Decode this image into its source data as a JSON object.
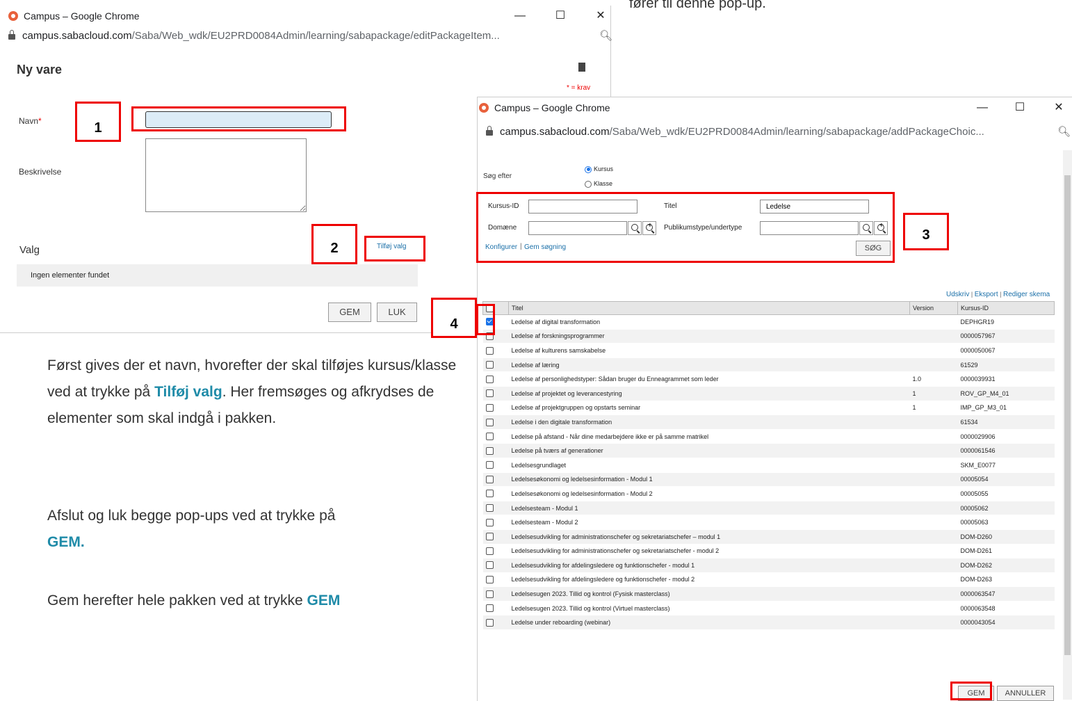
{
  "caption_top": "fører til denne pop-up.",
  "window1": {
    "title": "Campus – Google Chrome",
    "url_host": "campus.sabacloud.com",
    "url_path": "/Saba/Web_wdk/EU2PRD0084Admin/learning/sabapackage/editPackageItem...",
    "page_title": "Ny vare",
    "required_note": "* = krav",
    "name_label": "Navn",
    "required_star": "*",
    "name_value": "",
    "description_label": "Beskrivelse",
    "add_choice_link": "Tilføj valg",
    "choices_section": "Valg",
    "no_items": "Ingen elementer fundet",
    "save_button": "GEM",
    "close_button": "LUK"
  },
  "window2": {
    "title": "Campus – Google Chrome",
    "url_host": "campus.sabacloud.com",
    "url_path": "/Saba/Web_wdk/EU2PRD0084Admin/learning/sabapackage/addPackageChoic...",
    "search_for_label": "Søg efter",
    "radio_course": "Kursus",
    "radio_class": "Klasse",
    "course_id_label": "Kursus-ID",
    "course_id_value": "",
    "title_label": "Titel",
    "title_value": "Ledelse",
    "domain_label": "Domæne",
    "domain_value": "",
    "audience_label": "Publikumstype/undertype",
    "audience_value": "",
    "configure_link": "Konfigurer",
    "save_search_link": "Gem søgning",
    "search_button": "SØG",
    "print_link": "Udskriv",
    "export_link": "Eksport",
    "edit_schema_link": "Rediger skema",
    "columns": [
      "Titel",
      "Version",
      "Kursus-ID"
    ],
    "rows": [
      {
        "title": "Ledelse af digital transformation",
        "version": "",
        "id": "DEPHGR19",
        "checked": true
      },
      {
        "title": "Ledelse af forskningsprogrammer",
        "version": "",
        "id": "0000057967",
        "checked": false
      },
      {
        "title": "Ledelse af kulturens samskabelse",
        "version": "",
        "id": "0000050067",
        "checked": false
      },
      {
        "title": "Ledelse af læring",
        "version": "",
        "id": "61529",
        "checked": false
      },
      {
        "title": "Ledelse af personlighedstyper: Sådan bruger du Enneagrammet som leder",
        "version": "1.0",
        "id": "0000039931",
        "checked": false
      },
      {
        "title": "Ledelse af projektet og leverancestyring",
        "version": "1",
        "id": "ROV_GP_M4_01",
        "checked": false
      },
      {
        "title": "Ledelse af projektgruppen og opstarts seminar",
        "version": "1",
        "id": "IMP_GP_M3_01",
        "checked": false
      },
      {
        "title": "Ledelse i den digitale transformation",
        "version": "",
        "id": "61534",
        "checked": false
      },
      {
        "title": "Ledelse på afstand - Når dine medarbejdere ikke er på samme matrikel",
        "version": "",
        "id": "0000029906",
        "checked": false
      },
      {
        "title": "Ledelse på tværs af generationer",
        "version": "",
        "id": "0000061546",
        "checked": false
      },
      {
        "title": "Ledelsesgrundlaget",
        "version": "",
        "id": "SKM_E0077",
        "checked": false
      },
      {
        "title": "Ledelsesøkonomi og ledelsesinformation - Modul 1",
        "version": "",
        "id": "00005054",
        "checked": false
      },
      {
        "title": "Ledelsesøkonomi og ledelsesinformation - Modul 2",
        "version": "",
        "id": "00005055",
        "checked": false
      },
      {
        "title": "Ledelsesteam - Modul 1",
        "version": "",
        "id": "00005062",
        "checked": false
      },
      {
        "title": "Ledelsesteam - Modul 2",
        "version": "",
        "id": "00005063",
        "checked": false
      },
      {
        "title": "Ledelsesudvikling for administrationschefer og sekretariatschefer – modul 1",
        "version": "",
        "id": "DOM-D260",
        "checked": false
      },
      {
        "title": "Ledelsesudvikling for administrationschefer og sekretariatschefer - modul 2",
        "version": "",
        "id": "DOM-D261",
        "checked": false
      },
      {
        "title": "Ledelsesudvikling for afdelingsledere og funktionschefer - modul 1",
        "version": "",
        "id": "DOM-D262",
        "checked": false
      },
      {
        "title": "Ledelsesudvikling for afdelingsledere og funktionschefer - modul 2",
        "version": "",
        "id": "DOM-D263",
        "checked": false
      },
      {
        "title": "Ledelsesugen 2023. Tillid og kontrol (Fysisk masterclass)",
        "version": "",
        "id": "0000063547",
        "checked": false
      },
      {
        "title": "Ledelsesugen 2023. Tillid og kontrol (Virtuel masterclass)",
        "version": "",
        "id": "0000063548",
        "checked": false
      },
      {
        "title": "Ledelse under reboarding (webinar)",
        "version": "",
        "id": "0000043054",
        "checked": false
      }
    ],
    "save_button": "GEM",
    "cancel_button": "ANNULLER"
  },
  "callouts": [
    "1",
    "2",
    "3",
    "4"
  ],
  "instructions": {
    "p1_a": "Først gives der et navn, hvorefter der skal tilføjes kursus/klasse ved at trykke på ",
    "p1_hl": "Tilføj valg",
    "p1_b": ". Her fremsøges og afkrydses de elementer som skal indgå i pakken.",
    "p2_a": "Afslut og luk begge pop-ups ved at trykke på ",
    "p2_hl": "GEM.",
    "p3_a": "Gem herefter hele pakken ved at trykke ",
    "p3_hl": "GEM"
  },
  "colors": {
    "highlight": "#1f8ba8",
    "callout": "#e00000",
    "link": "#1a6fa8"
  }
}
